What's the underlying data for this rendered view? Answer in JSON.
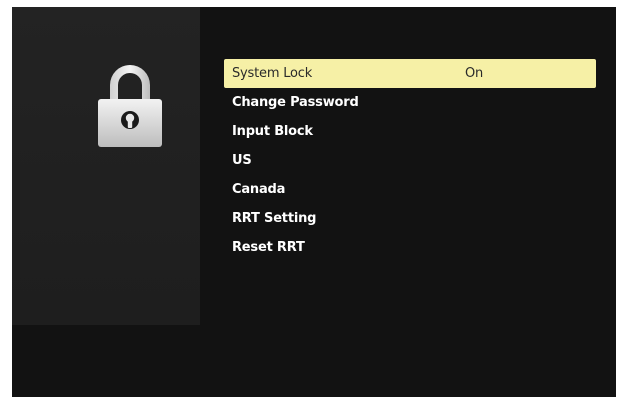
{
  "menu": {
    "items": [
      {
        "label": "System Lock",
        "value": "On",
        "selected": true
      },
      {
        "label": "Change Password"
      },
      {
        "label": "Input Block"
      },
      {
        "label": "US"
      },
      {
        "label": "Canada"
      },
      {
        "label": "RRT Setting"
      },
      {
        "label": "Reset RRT"
      }
    ]
  },
  "icons": {
    "left_panel_icon": "lock-icon"
  },
  "colors": {
    "background": "#121212",
    "panel": "#222222",
    "highlight": "#f6f0a6",
    "text": "#ffffff",
    "highlight_text": "#2a2a2a"
  }
}
